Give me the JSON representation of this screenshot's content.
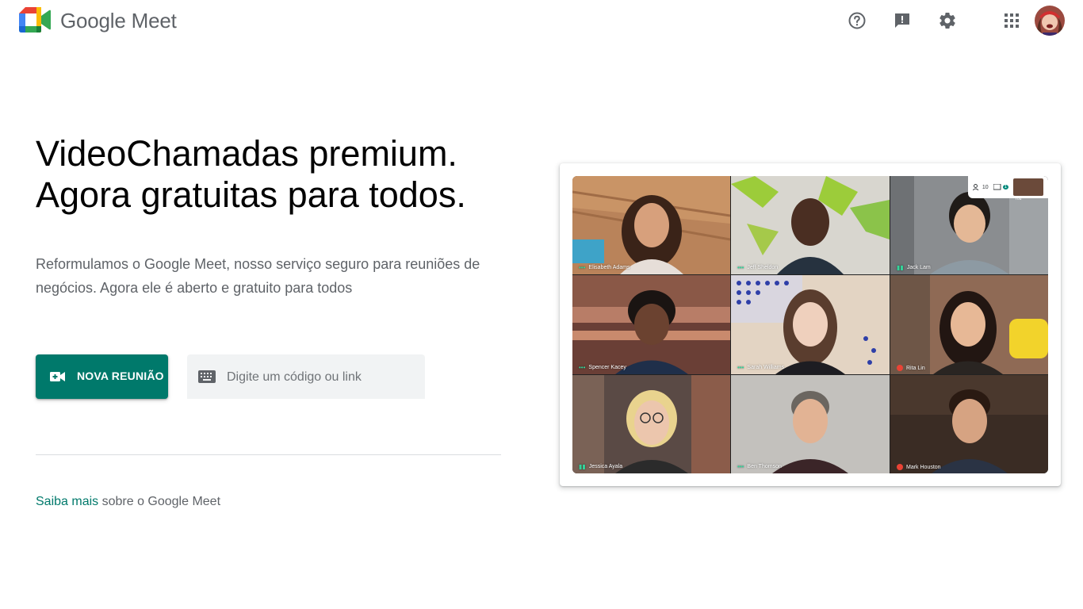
{
  "header": {
    "brand": "Google Meet",
    "icons": [
      "help-icon",
      "feedback-icon",
      "settings-icon",
      "apps-icon"
    ]
  },
  "hero": {
    "title_line1": "VideoChamadas premium.",
    "title_line2": "Agora gratuitas para todos.",
    "subtitle": "Reformulamos o Google Meet, nosso serviço seguro para reuniões de negócios. Agora ele é aberto e gratuito para todos"
  },
  "actions": {
    "new_meeting_label": "NOVA REUNIÃO",
    "code_placeholder": "Digite um código ou link"
  },
  "learn_more": {
    "link_text": "Saiba mais",
    "rest_text": " sobre o Google Meet"
  },
  "preview": {
    "participants_count": "10",
    "chat_count": "1",
    "self_label": "You",
    "tiles": [
      {
        "name": "Elisabeth Adams",
        "status": "speaking"
      },
      {
        "name": "Jeff Sheldon",
        "status": "speaking"
      },
      {
        "name": "Jack Lam",
        "status": "talking"
      },
      {
        "name": "Spencer Kacey",
        "status": "speaking"
      },
      {
        "name": "Sarah Williams",
        "status": "speaking"
      },
      {
        "name": "Rita Lin",
        "status": "muted"
      },
      {
        "name": "Jessica Ayala",
        "status": "talking"
      },
      {
        "name": "Ben Thomson",
        "status": "speaking"
      },
      {
        "name": "Mark Houston",
        "status": "muted"
      }
    ]
  },
  "colors": {
    "accent": "#00796b",
    "text_secondary": "#5f6368",
    "field_bg": "#f1f3f4"
  }
}
